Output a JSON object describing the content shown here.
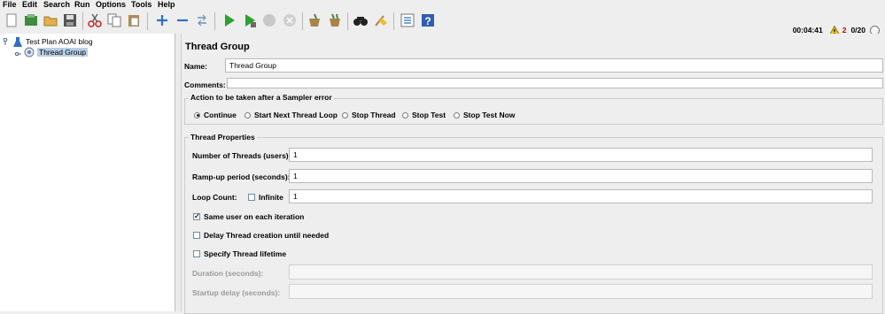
{
  "menu": [
    "File",
    "Edit",
    "Search",
    "Run",
    "Options",
    "Tools",
    "Help"
  ],
  "toolbar_icons": [
    "new-icon",
    "templates-icon",
    "open-icon",
    "save-icon",
    "cut-icon",
    "copy-icon",
    "paste-icon",
    "expand-icon",
    "collapse-icon",
    "toggle-icon",
    "start-icon",
    "start-no-pause-icon",
    "stop-icon",
    "shutdown-icon",
    "clear-icon",
    "clear-all-icon",
    "search-icon",
    "reset-search-icon",
    "function-helper-icon",
    "help-icon"
  ],
  "status": {
    "timer": "00:04:41",
    "warnings": "2",
    "threads": "0/20"
  },
  "tree": {
    "root": "Test Plan AOAI blog",
    "child": "Thread Group"
  },
  "panel": {
    "title": "Thread Group",
    "name_label": "Name:",
    "name_value": "Thread Group",
    "comments_label": "Comments:",
    "comments_value": "",
    "action_legend": "Action to be taken after a Sampler error",
    "actions": [
      "Continue",
      "Start Next Thread Loop",
      "Stop Thread",
      "Stop Test",
      "Stop Test Now"
    ],
    "selected_action": "Continue",
    "props_legend": "Thread Properties",
    "threads_label": "Number of Threads (users):",
    "threads_value": "1",
    "rampup_label": "Ramp-up period (seconds):",
    "rampup_value": "1",
    "loop_label": "Loop Count:",
    "infinite_label": "Infinite",
    "loop_value": "1",
    "same_user_label": "Same user on each iteration",
    "delay_label": "Delay Thread creation until needed",
    "lifetime_label": "Specify Thread lifetime",
    "duration_label": "Duration (seconds):",
    "startup_label": "Startup delay (seconds):"
  },
  "colors": {
    "selection": "#b8cfe5",
    "accent_blue": "#2f6fc4",
    "play_green": "#2ea12e"
  }
}
